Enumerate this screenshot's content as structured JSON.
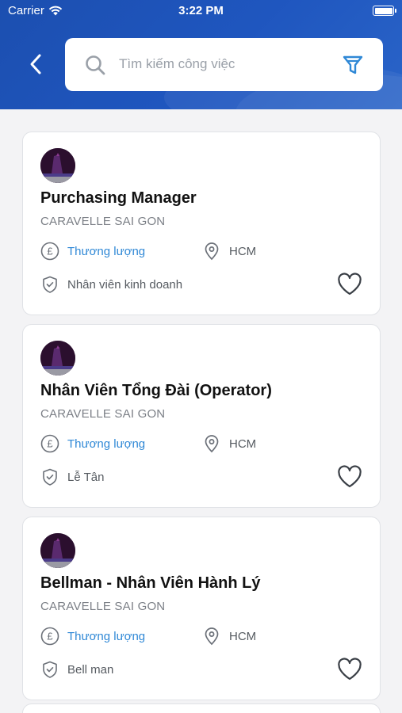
{
  "status_bar": {
    "carrier": "Carrier",
    "time": "3:22 PM"
  },
  "header": {
    "search": {
      "placeholder": "Tìm kiếm công việc",
      "value": ""
    },
    "icons": {
      "back": "chevron-left-icon",
      "search": "search-icon",
      "filter": "filter-icon"
    }
  },
  "colors": {
    "header_blue": "#1f56bf",
    "salary_blue": "#2f88d6",
    "filter_blue": "#2f88d6"
  },
  "jobs": [
    {
      "title": "Purchasing Manager",
      "company": "CARAVELLE SAI GON",
      "salary": "Thương lượng",
      "location": "HCM",
      "category": "Nhân viên kinh doanh"
    },
    {
      "title": "Nhân Viên Tổng Đài (Operator)",
      "company": "CARAVELLE SAI GON",
      "salary": "Thương lượng",
      "location": "HCM",
      "category": "Lễ Tân"
    },
    {
      "title": "Bellman - Nhân Viên Hành Lý",
      "company": "CARAVELLE SAI GON",
      "salary": "Thương lượng",
      "location": "HCM",
      "category": "Bell man"
    }
  ]
}
